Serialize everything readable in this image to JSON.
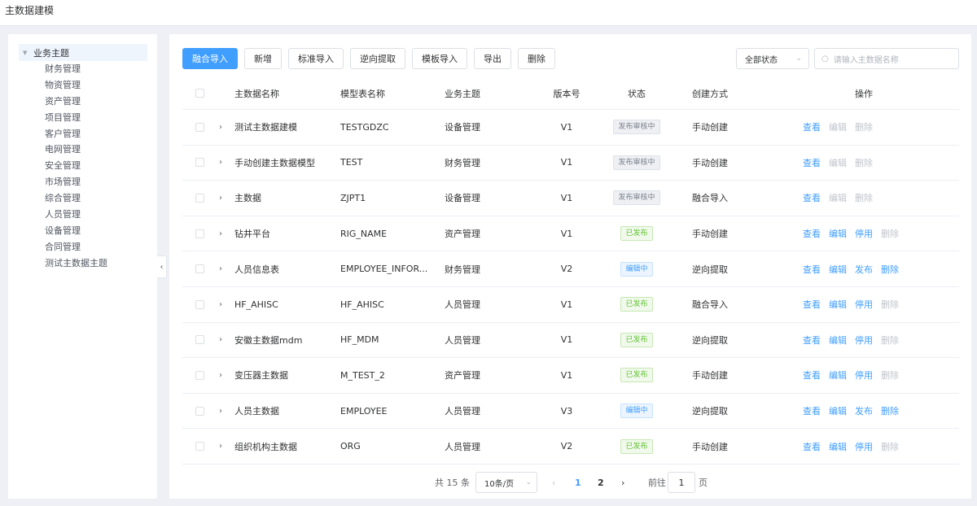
{
  "header": {
    "title": "主数据建模"
  },
  "sidebar": {
    "root": "业务主题",
    "items": [
      "财务管理",
      "物资管理",
      "资产管理",
      "项目管理",
      "客户管理",
      "电网管理",
      "安全管理",
      "市场管理",
      "综合管理",
      "人员管理",
      "设备管理",
      "合同管理",
      "测试主数据主题"
    ]
  },
  "toolbar": {
    "buttons": [
      "融合导入",
      "新增",
      "标准导入",
      "逆向提取",
      "模板导入",
      "导出",
      "删除"
    ],
    "status_select": "全部状态",
    "search_placeholder": "请输入主数据名称"
  },
  "table": {
    "columns": [
      "主数据名称",
      "模型表名称",
      "业务主题",
      "版本号",
      "状态",
      "创建方式",
      "操作"
    ],
    "rows": [
      {
        "name": "测试主数据建模",
        "table": "TESTGDZC",
        "theme": "设备管理",
        "version": "V1",
        "status": "发布审核中",
        "create": "手动创建",
        "ops": [
          "查看",
          "编辑",
          "删除"
        ]
      },
      {
        "name": "手动创建主数据模型",
        "table": "TEST",
        "theme": "财务管理",
        "version": "V1",
        "status": "发布审核中",
        "create": "手动创建",
        "ops": [
          "查看",
          "编辑",
          "删除"
        ]
      },
      {
        "name": "主数据",
        "table": "ZJPT1",
        "theme": "设备管理",
        "version": "V1",
        "status": "发布审核中",
        "create": "融合导入",
        "ops": [
          "查看",
          "编辑",
          "删除"
        ]
      },
      {
        "name": "钻井平台",
        "table": "RIG_NAME",
        "theme": "资产管理",
        "version": "V1",
        "status": "已发布",
        "create": "手动创建",
        "ops": [
          "查看",
          "编辑",
          "停用",
          "删除"
        ]
      },
      {
        "name": "人员信息表",
        "table": "EMPLOYEE_INFOR...",
        "theme": "财务管理",
        "version": "V2",
        "status": "编辑中",
        "create": "逆向提取",
        "ops": [
          "查看",
          "编辑",
          "发布",
          "删除"
        ]
      },
      {
        "name": "HF_AHISC",
        "table": "HF_AHISC",
        "theme": "人员管理",
        "version": "V1",
        "status": "已发布",
        "create": "融合导入",
        "ops": [
          "查看",
          "编辑",
          "停用",
          "删除"
        ]
      },
      {
        "name": "安徽主数据mdm",
        "table": "HF_MDM",
        "theme": "人员管理",
        "version": "V1",
        "status": "已发布",
        "create": "逆向提取",
        "ops": [
          "查看",
          "编辑",
          "停用",
          "删除"
        ]
      },
      {
        "name": "变压器主数据",
        "table": "M_TEST_2",
        "theme": "资产管理",
        "version": "V1",
        "status": "已发布",
        "create": "手动创建",
        "ops": [
          "查看",
          "编辑",
          "停用",
          "删除"
        ]
      },
      {
        "name": "人员主数据",
        "table": "EMPLOYEE",
        "theme": "人员管理",
        "version": "V3",
        "status": "编辑中",
        "create": "逆向提取",
        "ops": [
          "查看",
          "编辑",
          "发布",
          "删除"
        ]
      },
      {
        "name": "组织机构主数据",
        "table": "ORG",
        "theme": "人员管理",
        "version": "V2",
        "status": "已发布",
        "create": "手动创建",
        "ops": [
          "查看",
          "编辑",
          "停用",
          "删除"
        ]
      }
    ]
  },
  "status_colors": {
    "发布审核中": {
      "bg": "#eef0f4",
      "border": "#dde1e8",
      "text": "#7c828c"
    },
    "已发布": {
      "bg": "#f0f9eb",
      "border": "#c8e8b4",
      "text": "#67c23a"
    },
    "编辑中": {
      "bg": "#ecf5ff",
      "border": "#c6e2ff",
      "text": "#409eff"
    }
  },
  "pagination": {
    "total": "共 15 条",
    "page_size": "10条/页",
    "pages": [
      "1",
      "2"
    ],
    "goto_label": "前往",
    "goto_value": "1",
    "page_suffix": "页"
  }
}
